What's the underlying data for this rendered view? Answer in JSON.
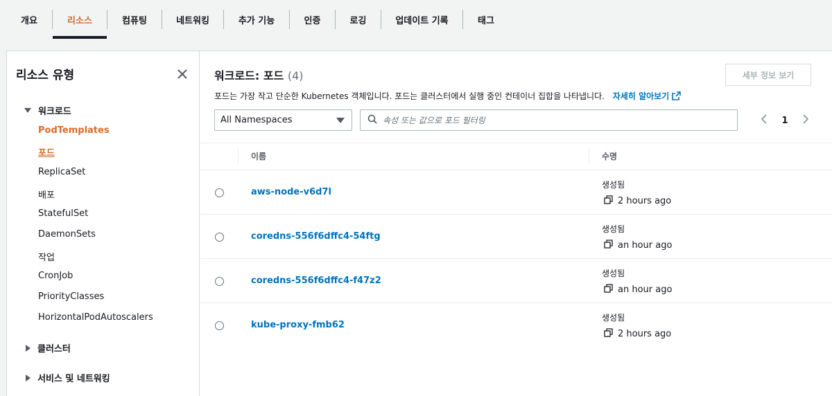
{
  "tabs": [
    {
      "label": "개요"
    },
    {
      "label": "리소스"
    },
    {
      "label": "컴퓨팅"
    },
    {
      "label": "네트워킹"
    },
    {
      "label": "추가 기능"
    },
    {
      "label": "인증"
    },
    {
      "label": "로깅"
    },
    {
      "label": "업데이트 기록"
    },
    {
      "label": "태그"
    }
  ],
  "sidebar": {
    "title": "리소스 유형",
    "workloads": {
      "label": "워크로드",
      "items": [
        {
          "label": "PodTemplates"
        },
        {
          "label": "포드"
        },
        {
          "label": "ReplicaSet"
        },
        {
          "label": "배포"
        },
        {
          "label": "StatefulSet"
        },
        {
          "label": "DaemonSets"
        },
        {
          "label": "작업"
        },
        {
          "label": "CronJob"
        },
        {
          "label": "PriorityClasses"
        },
        {
          "label": "HorizontalPodAutoscalers"
        }
      ]
    },
    "cluster": {
      "label": "클러스터"
    },
    "service_networking": {
      "label": "서비스 및 네트워킹"
    }
  },
  "main": {
    "title": "워크로드: 포드",
    "count": "(4)",
    "details_button": "세부 정보 보기",
    "description": "포드는 가장 작고 단순한 Kubernetes 객체입니다. 포드는 클러스터에서 실행 중인 컨테이너 집합을 나타냅니다.",
    "learn_more": "자세히 알아보기",
    "namespace_select": "All Namespaces",
    "search_placeholder": "속성 또는 값으로 포드 필터링",
    "page": "1",
    "columns": {
      "name": "이름",
      "lifetime": "수명"
    },
    "rows": [
      {
        "name": "aws-node-v6d7l",
        "label": "생성됨",
        "age": "2 hours ago"
      },
      {
        "name": "coredns-556f6dffc4-54ftg",
        "label": "생성됨",
        "age": "an hour ago"
      },
      {
        "name": "coredns-556f6dffc4-f47z2",
        "label": "생성됨",
        "age": "an hour ago"
      },
      {
        "name": "kube-proxy-fmb62",
        "label": "생성됨",
        "age": "2 hours ago"
      }
    ]
  },
  "colors": {
    "accent": "#d36d2c",
    "link": "#0073bb",
    "text": "#16191f"
  }
}
